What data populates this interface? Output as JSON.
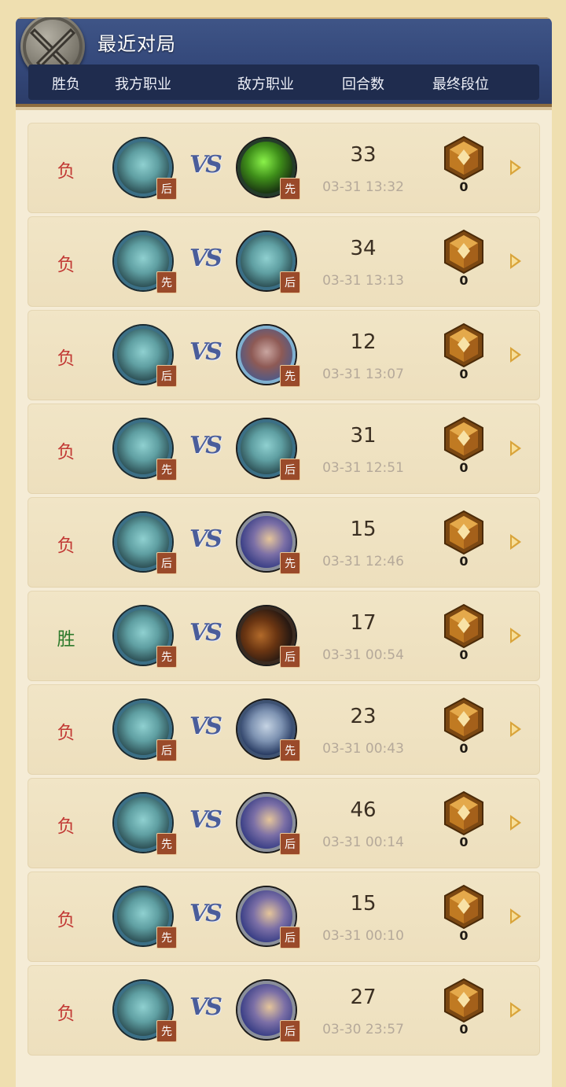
{
  "header": {
    "title": "最近对局",
    "columns": [
      "胜负",
      "我方职业",
      "敌方职业",
      "回合数",
      "最终段位"
    ]
  },
  "colors": {
    "header_bg": "#34487a",
    "lose": "#c23a35",
    "win": "#2e7a2c",
    "turn_badge": "#9a4a2a",
    "rank_gem": "#c07a22"
  },
  "matches": [
    {
      "result": "负",
      "my_class": "mage-icon",
      "my_order": "后",
      "opp_class": "warlock-icon",
      "opp_order": "先",
      "turns": "33",
      "date": "03-31 13:32",
      "rank": "0"
    },
    {
      "result": "负",
      "my_class": "mage-icon",
      "my_order": "先",
      "opp_class": "mage-icon",
      "opp_order": "后",
      "turns": "34",
      "date": "03-31 13:13",
      "rank": "0"
    },
    {
      "result": "负",
      "my_class": "mage-icon",
      "my_order": "后",
      "opp_class": "druid-icon",
      "opp_order": "先",
      "turns": "12",
      "date": "03-31 13:07",
      "rank": "0"
    },
    {
      "result": "负",
      "my_class": "mage-icon",
      "my_order": "先",
      "opp_class": "mage-icon",
      "opp_order": "后",
      "turns": "31",
      "date": "03-31 12:51",
      "rank": "0"
    },
    {
      "result": "负",
      "my_class": "mage-icon",
      "my_order": "后",
      "opp_class": "priest-icon",
      "opp_order": "先",
      "turns": "15",
      "date": "03-31 12:46",
      "rank": "0"
    },
    {
      "result": "胜",
      "my_class": "mage-icon",
      "my_order": "先",
      "opp_class": "hunter-icon",
      "opp_order": "后",
      "turns": "17",
      "date": "03-31 00:54",
      "rank": "0"
    },
    {
      "result": "负",
      "my_class": "mage-icon",
      "my_order": "后",
      "opp_class": "warrior-icon",
      "opp_order": "先",
      "turns": "23",
      "date": "03-31 00:43",
      "rank": "0"
    },
    {
      "result": "负",
      "my_class": "mage-icon",
      "my_order": "先",
      "opp_class": "priest-icon",
      "opp_order": "后",
      "turns": "46",
      "date": "03-31 00:14",
      "rank": "0"
    },
    {
      "result": "负",
      "my_class": "mage-icon",
      "my_order": "先",
      "opp_class": "priest-icon",
      "opp_order": "后",
      "turns": "15",
      "date": "03-31 00:10",
      "rank": "0"
    },
    {
      "result": "负",
      "my_class": "mage-icon",
      "my_order": "先",
      "opp_class": "priest-icon",
      "opp_order": "后",
      "turns": "27",
      "date": "03-30 23:57",
      "rank": "0"
    }
  ]
}
